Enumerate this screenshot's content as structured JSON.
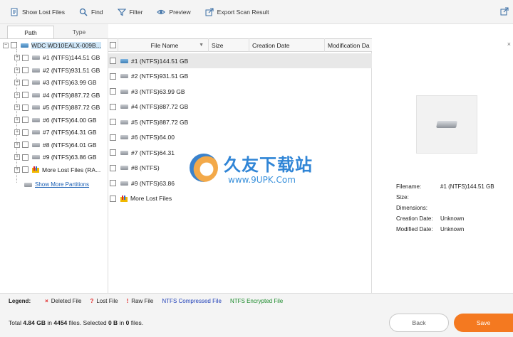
{
  "toolbar": {
    "show_lost_files": "Show Lost Files",
    "find": "Find",
    "filter": "Filter",
    "preview": "Preview",
    "export_scan_result": "Export Scan Result"
  },
  "tabs": {
    "path": "Path",
    "type": "Type"
  },
  "tree": {
    "root": "WDC WD10EALX-009B...",
    "items": [
      "#1 (NTFS)144.51 GB",
      "#2 (NTFS)931.51 GB",
      "#3 (NTFS)63.99 GB",
      "#4 (NTFS)887.72 GB",
      "#5 (NTFS)887.72 GB",
      "#6 (NTFS)64.00 GB",
      "#7 (NTFS)64.31 GB",
      "#8 (NTFS)64.01 GB",
      "#9 (NTFS)63.86 GB",
      "More Lost Files (RA..."
    ],
    "show_more": "Show More Partitions"
  },
  "columns": {
    "file_name": "File Name",
    "size": "Size",
    "creation_date": "Creation Date",
    "modification_date": "Modification Da"
  },
  "files": [
    "#1 (NTFS)144.51 GB",
    "#2 (NTFS)931.51 GB",
    "#3 (NTFS)63.99 GB",
    "#4 (NTFS)887.72 GB",
    "#5 (NTFS)887.72 GB",
    "#6 (NTFS)64.00",
    "#7 (NTFS)64.31",
    "#8 (NTFS)",
    "#9 (NTFS)63.86",
    "More Lost Files"
  ],
  "watermark": {
    "title": "久友下载站",
    "url": "www.9UPK.Com"
  },
  "preview": {
    "filename_label": "Filename:",
    "filename_value": "#1 (NTFS)144.51 GB",
    "size_label": "Size:",
    "dimensions_label": "Dimensions:",
    "creation_label": "Creation Date:",
    "creation_value": "Unknown",
    "modified_label": "Modified Date:",
    "modified_value": "Unknown"
  },
  "legend": {
    "title": "Legend:",
    "deleted": "Deleted File",
    "lost": "Lost File",
    "raw": "Raw File",
    "compressed": "NTFS Compressed File",
    "encrypted": "NTFS Encrypted File",
    "compressed_color": "#1f3fb8",
    "encrypted_color": "#1a8a2a"
  },
  "status": {
    "total_label": "Total",
    "total_size": "4.84 GB",
    "in_label": "in",
    "file_count": "4454",
    "files_selected_label": "files.  Selected",
    "selected_size": "0 B",
    "in2_label": "in",
    "selected_count": "0",
    "files_end": "files."
  },
  "buttons": {
    "back": "Back",
    "save": "Save"
  },
  "colors": {
    "accent": "#f47920",
    "selection": "#cfe6f7"
  }
}
